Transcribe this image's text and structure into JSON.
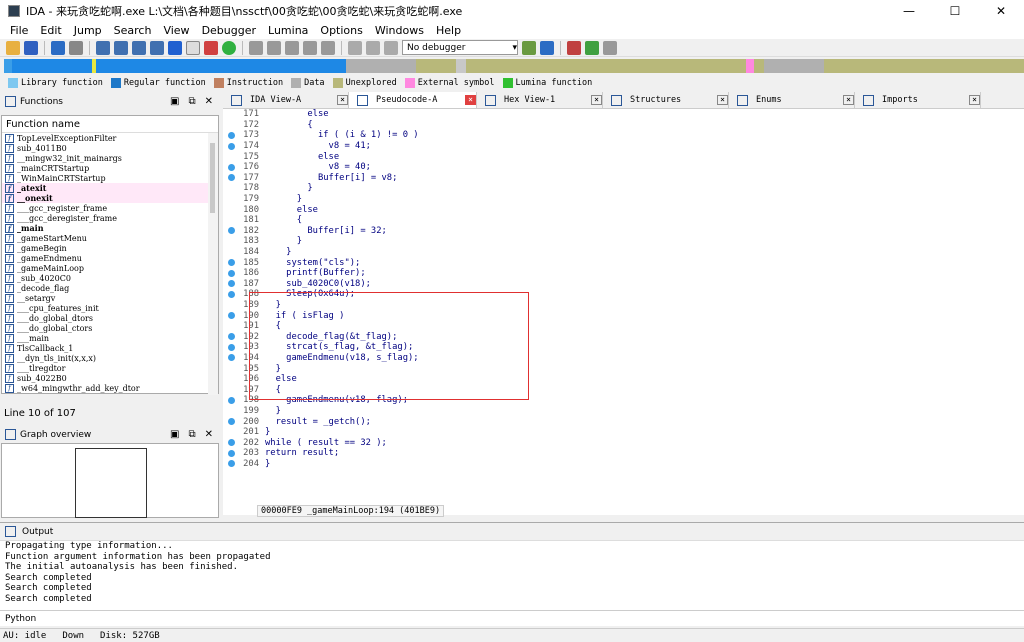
{
  "window": {
    "title": "IDA - 来玩贪吃蛇啊.exe L:\\文档\\各种题目\\nssctf\\00贪吃蛇\\00贪吃蛇\\来玩贪吃蛇啊.exe",
    "minimize": "—",
    "maximize": "☐",
    "close": "✕"
  },
  "menu": [
    "File",
    "Edit",
    "Jump",
    "Search",
    "View",
    "Debugger",
    "Lumina",
    "Options",
    "Windows",
    "Help"
  ],
  "toolbar": {
    "debugger": "No debugger"
  },
  "legend": [
    {
      "label": "Library function",
      "color": "#7ec8f0"
    },
    {
      "label": "Regular function",
      "color": "#1e78c8"
    },
    {
      "label": "Instruction",
      "color": "#c08060"
    },
    {
      "label": "Data",
      "color": "#b0b0b0"
    },
    {
      "label": "Unexplored",
      "color": "#b8b87a"
    },
    {
      "label": "External symbol",
      "color": "#ff88e0"
    },
    {
      "label": "Lumina function",
      "color": "#30c030"
    }
  ],
  "functions": {
    "title": "Functions",
    "column": "Function name",
    "line_info": "Line 10 of 107",
    "items": [
      {
        "name": "TopLevelExceptionFilter",
        "lib": false,
        "bold": false
      },
      {
        "name": "sub_4011B0",
        "lib": false,
        "bold": false
      },
      {
        "name": "__mingw32_init_mainargs",
        "lib": false,
        "bold": false
      },
      {
        "name": "_mainCRTStartup",
        "lib": false,
        "bold": false
      },
      {
        "name": "_WinMainCRTStartup",
        "lib": false,
        "bold": false
      },
      {
        "name": "_atexit",
        "lib": true,
        "bold": true
      },
      {
        "name": "__onexit",
        "lib": true,
        "bold": true
      },
      {
        "name": "___gcc_register_frame",
        "lib": false,
        "bold": false
      },
      {
        "name": "___gcc_deregister_frame",
        "lib": false,
        "bold": false
      },
      {
        "name": "_main",
        "lib": false,
        "bold": true
      },
      {
        "name": "_gameStartMenu",
        "lib": false,
        "bold": false
      },
      {
        "name": "_gameBegin",
        "lib": false,
        "bold": false
      },
      {
        "name": "_gameEndmenu",
        "lib": false,
        "bold": false
      },
      {
        "name": "_gameMainLoop",
        "lib": false,
        "bold": false
      },
      {
        "name": "_sub_4020C0",
        "lib": false,
        "bold": false
      },
      {
        "name": "_decode_flag",
        "lib": false,
        "bold": false
      },
      {
        "name": "__setargv",
        "lib": false,
        "bold": false
      },
      {
        "name": "___cpu_features_init",
        "lib": false,
        "bold": false
      },
      {
        "name": "___do_global_dtors",
        "lib": false,
        "bold": false
      },
      {
        "name": "___do_global_ctors",
        "lib": false,
        "bold": false
      },
      {
        "name": "___main",
        "lib": false,
        "bold": false
      },
      {
        "name": "TlsCallback_1",
        "lib": false,
        "bold": false
      },
      {
        "name": "__dyn_tls_init(x,x,x)",
        "lib": false,
        "bold": false
      },
      {
        "name": "___tlregdtor",
        "lib": false,
        "bold": false
      },
      {
        "name": "sub_4022B0",
        "lib": false,
        "bold": false
      },
      {
        "name": "_w64_mingwthr_add_key_dtor",
        "lib": false,
        "bold": false
      }
    ]
  },
  "graph": {
    "title": "Graph overview"
  },
  "tabs": [
    {
      "label": "IDA View-A",
      "active": false
    },
    {
      "label": "Pseudocode-A",
      "active": true
    },
    {
      "label": "Hex View-1",
      "active": false
    },
    {
      "label": "Structures",
      "active": false
    },
    {
      "label": "Enums",
      "active": false
    },
    {
      "label": "Imports",
      "active": false
    }
  ],
  "code": [
    {
      "n": "171",
      "dot": false,
      "t": "        else"
    },
    {
      "n": "172",
      "dot": false,
      "t": "        {"
    },
    {
      "n": "173",
      "dot": true,
      "t": "          if ( (i & 1) != 0 )"
    },
    {
      "n": "174",
      "dot": true,
      "t": "            v8 = 41;"
    },
    {
      "n": "175",
      "dot": false,
      "t": "          else"
    },
    {
      "n": "176",
      "dot": true,
      "t": "            v8 = 40;"
    },
    {
      "n": "177",
      "dot": true,
      "t": "          Buffer[i] = v8;"
    },
    {
      "n": "178",
      "dot": false,
      "t": "        }"
    },
    {
      "n": "179",
      "dot": false,
      "t": "      }"
    },
    {
      "n": "180",
      "dot": false,
      "t": "      else"
    },
    {
      "n": "181",
      "dot": false,
      "t": "      {"
    },
    {
      "n": "182",
      "dot": true,
      "t": "        Buffer[i] = 32;"
    },
    {
      "n": "183",
      "dot": false,
      "t": "      }"
    },
    {
      "n": "184",
      "dot": false,
      "t": "    }"
    },
    {
      "n": "185",
      "dot": true,
      "t": "    system(\"cls\");"
    },
    {
      "n": "186",
      "dot": true,
      "t": "    printf(Buffer);"
    },
    {
      "n": "187",
      "dot": true,
      "t": "    sub_4020C0(v18);"
    },
    {
      "n": "188",
      "dot": true,
      "t": "    Sleep(0x64u);"
    },
    {
      "n": "189",
      "dot": false,
      "t": "  }"
    },
    {
      "n": "190",
      "dot": true,
      "t": "  if ( isFlag )"
    },
    {
      "n": "191",
      "dot": false,
      "t": "  {"
    },
    {
      "n": "192",
      "dot": true,
      "t": "    decode_flag(&t_flag);"
    },
    {
      "n": "193",
      "dot": true,
      "t": "    strcat(s_flag, &t_flag);"
    },
    {
      "n": "194",
      "dot": true,
      "t": "    gameEndmenu(v18, s_flag);"
    },
    {
      "n": "195",
      "dot": false,
      "t": "  }"
    },
    {
      "n": "196",
      "dot": false,
      "t": "  else"
    },
    {
      "n": "197",
      "dot": false,
      "t": "  {"
    },
    {
      "n": "198",
      "dot": true,
      "t": "    gameEndmenu(v18, flag);"
    },
    {
      "n": "199",
      "dot": false,
      "t": "  }"
    },
    {
      "n": "200",
      "dot": true,
      "t": "  result = _getch();"
    },
    {
      "n": "201",
      "dot": false,
      "t": "}"
    },
    {
      "n": "202",
      "dot": true,
      "t": "while ( result == 32 );"
    },
    {
      "n": "203",
      "dot": true,
      "t": "return result;"
    },
    {
      "n": "204",
      "dot": true,
      "t": "}"
    }
  ],
  "address_bar": "00000FE9 _gameMainLoop:194 (401BE9)",
  "output": {
    "title": "Output",
    "lines": [
      "Propagating type information...",
      "Function argument information has been propagated",
      "The initial autoanalysis has been finished.",
      "Search completed",
      "Search completed",
      "Search completed"
    ]
  },
  "python_label": "Python",
  "status": {
    "au": "AU:  idle",
    "mode": "Down",
    "disk": "Disk: 527GB"
  }
}
